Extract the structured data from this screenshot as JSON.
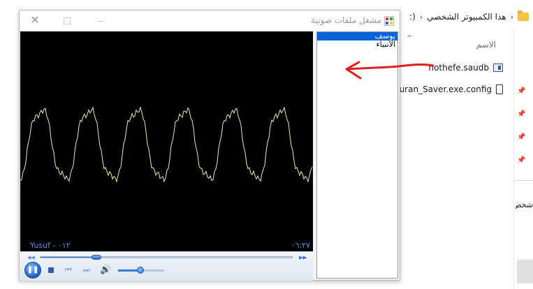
{
  "explorer": {
    "breadcrumb": "هذا الكمبيوتر الشخصي",
    "breadcrumb_tail": "(:",
    "column_name": "الاسم",
    "files": [
      {
        "name": "hothefe.saudb",
        "icon": "database-file-icon"
      },
      {
        "name": "Quran_Saver.exe.config",
        "icon": "config-file-icon"
      }
    ],
    "side_text": "شخص"
  },
  "player": {
    "title": "مشغل ملفات صوتية",
    "track_label": "Yusuf - ٠١٢",
    "time_label": "٠٦:٢٧",
    "seek_progress": 0.22,
    "volume_level": 0.48,
    "playlist": [
      {
        "label": "يوسف",
        "selected": true
      },
      {
        "label": "الأنبياء",
        "selected": false
      }
    ]
  },
  "colors": {
    "waveform": "#d9f7a9",
    "selection": "#0a64d8",
    "annotation": "#e02020",
    "accent": "#3a7bd5"
  }
}
